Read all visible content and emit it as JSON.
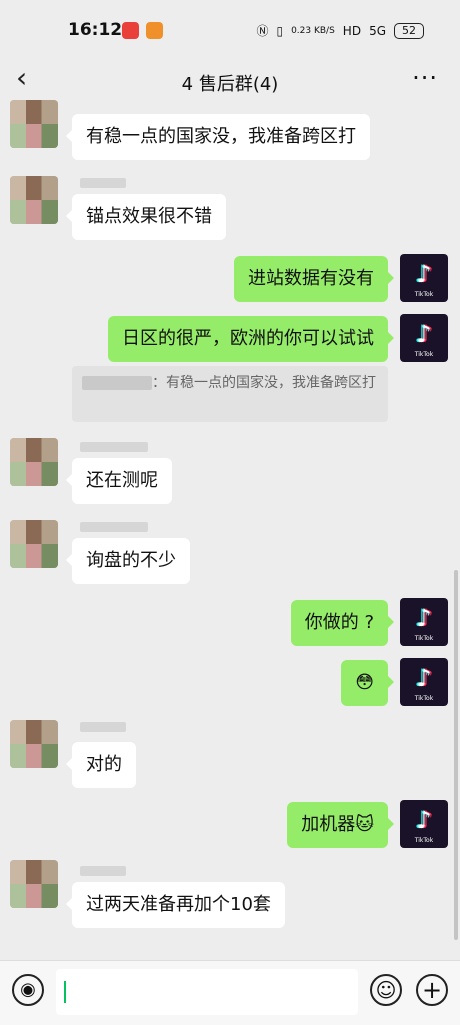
{
  "status": {
    "time": "16:12",
    "speed": "0.23 KB/S",
    "network": "5G",
    "battery": "52"
  },
  "header": {
    "title": "4    售后群(4)",
    "back_icon": "chevron-left-icon",
    "more_icon": "more-icon"
  },
  "messages": [
    {
      "side": "in",
      "text": "有稳一点的国家没，我准备跨区打"
    },
    {
      "side": "in",
      "text": "锚点效果很不错"
    },
    {
      "side": "out",
      "text": "进站数据有没有"
    },
    {
      "side": "out",
      "text": "日区的很严，欧洲的你可以试试"
    },
    {
      "side": "in",
      "text": "还在测呢"
    },
    {
      "side": "in",
      "text": "询盘的不少"
    },
    {
      "side": "out",
      "text": "你做的    ?"
    },
    {
      "side": "out",
      "text": "😳"
    },
    {
      "side": "in",
      "text": "对的"
    },
    {
      "side": "out",
      "text": "加机器🐱"
    },
    {
      "side": "in",
      "text": "过两天准备再加个10套"
    }
  ],
  "quote": {
    "text": "：有稳一点的国家没，我准备跨区打"
  },
  "avatar_label": "TikTok",
  "colors": {
    "background": "#ededed",
    "outgoing": "#95ec69",
    "incoming": "#ffffff"
  }
}
